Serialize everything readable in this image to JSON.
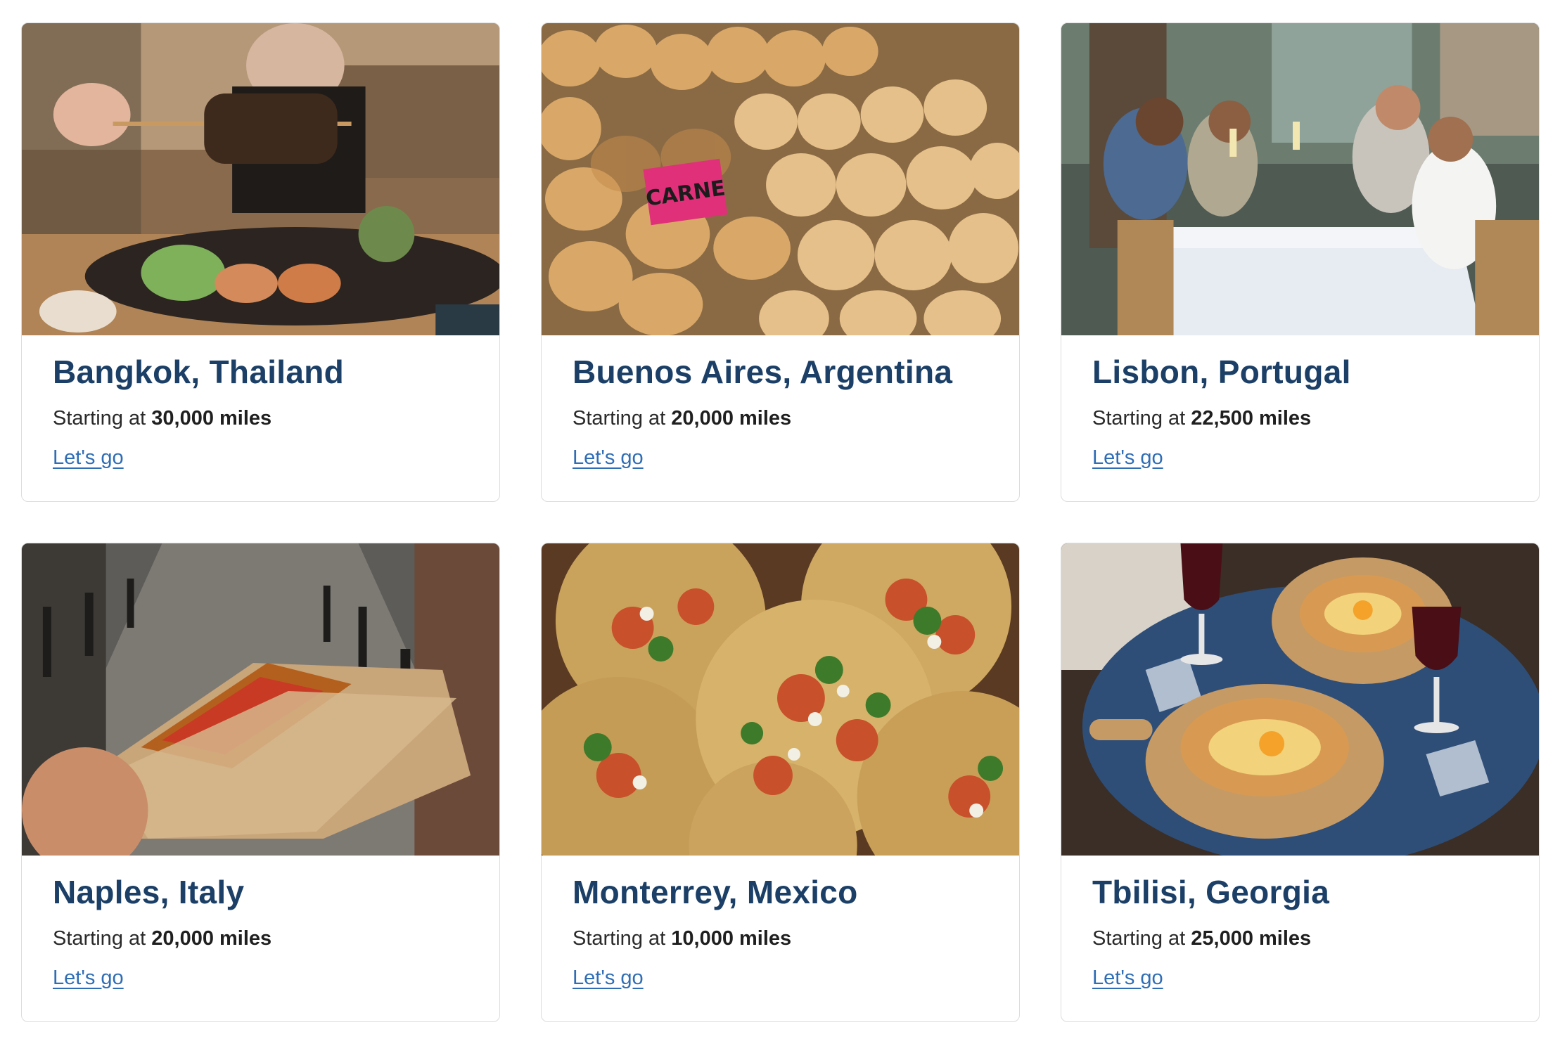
{
  "cards": [
    {
      "city": "Bangkok, Thailand",
      "price_prefix": "Starting at",
      "price_value": "30,000 miles",
      "link": "Let's go",
      "photo": "street-food-skewer-photo"
    },
    {
      "city": "Buenos Aires, Argentina",
      "price_prefix": "Starting at",
      "price_value": "20,000 miles",
      "link": "Let's go",
      "photo": "empanadas-photo",
      "photo_sign": "CARNE"
    },
    {
      "city": "Lisbon, Portugal",
      "price_prefix": "Starting at",
      "price_value": "22,500 miles",
      "link": "Let's go",
      "photo": "outdoor-dining-toast-photo"
    },
    {
      "city": "Naples, Italy",
      "price_prefix": "Starting at",
      "price_value": "20,000 miles",
      "link": "Let's go",
      "photo": "folded-pizza-photo"
    },
    {
      "city": "Monterrey, Mexico",
      "price_prefix": "Starting at",
      "price_value": "10,000 miles",
      "link": "Let's go",
      "photo": "tacos-photo"
    },
    {
      "city": "Tbilisi, Georgia",
      "price_prefix": "Starting at",
      "price_value": "25,000 miles",
      "link": "Let's go",
      "photo": "khachapuri-wine-photo"
    }
  ],
  "colors": {
    "title": "#1b3f66",
    "link": "#2f6db5",
    "border": "#dcdcdc"
  }
}
